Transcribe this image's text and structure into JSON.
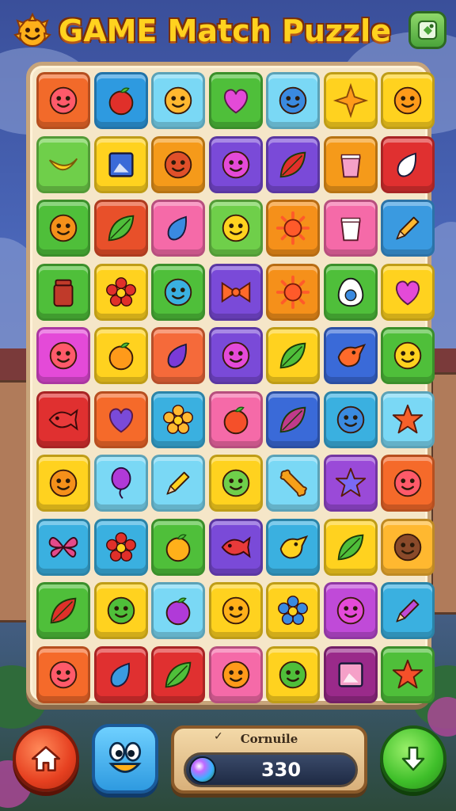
{
  "header": {
    "title": "GAME Match Puzzle",
    "logo_icon": "smiley-sun-icon",
    "menu_icon": "map-menu-icon"
  },
  "board": {
    "rows": 10,
    "cols": 7,
    "tiles": [
      {
        "icon": "face",
        "bg": "#f26a2a",
        "fg": "#ff5a6a"
      },
      {
        "icon": "fruit",
        "bg": "#2e9ae0",
        "fg": "#e0302a"
      },
      {
        "icon": "face",
        "bg": "#7ad8f5",
        "fg": "#ffb830"
      },
      {
        "icon": "heart",
        "bg": "#4fbf3a",
        "fg": "#e44ad8"
      },
      {
        "icon": "face",
        "bg": "#7ad8f5",
        "fg": "#3a8ae0"
      },
      {
        "icon": "star4",
        "bg": "#ffd21f",
        "fg": "#ff9a1a"
      },
      {
        "icon": "face",
        "bg": "#ffd21f",
        "fg": "#ff9a1a"
      },
      {
        "icon": "banana",
        "bg": "#6fcf4a",
        "fg": "#ffd21f"
      },
      {
        "icon": "frame",
        "bg": "#ffd21f",
        "fg": "#3a6ad8"
      },
      {
        "icon": "face",
        "bg": "#f59a1a",
        "fg": "#e0502a"
      },
      {
        "icon": "face",
        "bg": "#7a4ad8",
        "fg": "#e44ad8"
      },
      {
        "icon": "leaf",
        "bg": "#7a4ad8",
        "fg": "#e0302a"
      },
      {
        "icon": "cup",
        "bg": "#f59a1a",
        "fg": "#f5a0c8"
      },
      {
        "icon": "drop",
        "bg": "#e03030",
        "fg": "#ffffff"
      },
      {
        "icon": "face",
        "bg": "#4fbf3a",
        "fg": "#f5901a"
      },
      {
        "icon": "leaf",
        "bg": "#e8502a",
        "fg": "#4fbf3a"
      },
      {
        "icon": "drop",
        "bg": "#f56aa8",
        "fg": "#3a8ae0"
      },
      {
        "icon": "face",
        "bg": "#6fcf4a",
        "fg": "#ffd21f"
      },
      {
        "icon": "sun",
        "bg": "#f5901a",
        "fg": "#ff5a2a"
      },
      {
        "icon": "cup",
        "bg": "#f56aa8",
        "fg": "#ffffff"
      },
      {
        "icon": "pencil",
        "bg": "#3a9ae0",
        "fg": "#ffb830"
      },
      {
        "icon": "jar",
        "bg": "#4fbf3a",
        "fg": "#c03a2a"
      },
      {
        "icon": "flower",
        "bg": "#ffd21f",
        "fg": "#e0302a"
      },
      {
        "icon": "face",
        "bg": "#4fbf3a",
        "fg": "#3ab0e0"
      },
      {
        "icon": "bow",
        "bg": "#7a4ad8",
        "fg": "#ff6a2a"
      },
      {
        "icon": "sun",
        "bg": "#f5901a",
        "fg": "#ff5a2a"
      },
      {
        "icon": "egg",
        "bg": "#4fbf3a",
        "fg": "#ffffff"
      },
      {
        "icon": "heart",
        "bg": "#ffd21f",
        "fg": "#e44ad8"
      },
      {
        "icon": "face",
        "bg": "#e44ad8",
        "fg": "#ff5a6a"
      },
      {
        "icon": "fruit",
        "bg": "#ffd21f",
        "fg": "#ff9a1a"
      },
      {
        "icon": "drop",
        "bg": "#f56a3a",
        "fg": "#7a3ad8"
      },
      {
        "icon": "face",
        "bg": "#7a4ad8",
        "fg": "#e44ad8"
      },
      {
        "icon": "leaf",
        "bg": "#ffd21f",
        "fg": "#4fbf3a"
      },
      {
        "icon": "bird",
        "bg": "#3a6ad8",
        "fg": "#ff6a2a"
      },
      {
        "icon": "face",
        "bg": "#4fbf3a",
        "fg": "#ffd21f"
      },
      {
        "icon": "fish",
        "bg": "#e03030",
        "fg": "#e83a3a"
      },
      {
        "icon": "heart",
        "bg": "#f56a2a",
        "fg": "#7a4ad8"
      },
      {
        "icon": "flower",
        "bg": "#3ab0e0",
        "fg": "#ffb830"
      },
      {
        "icon": "fruit",
        "bg": "#f56aa8",
        "fg": "#f5502a"
      },
      {
        "icon": "leaf",
        "bg": "#3a6ad8",
        "fg": "#c03a8a"
      },
      {
        "icon": "face",
        "bg": "#3ab0e0",
        "fg": "#3a8ae0"
      },
      {
        "icon": "star",
        "bg": "#7ad8f5",
        "fg": "#f5602a"
      },
      {
        "icon": "face",
        "bg": "#ffd21f",
        "fg": "#f5901a"
      },
      {
        "icon": "balloon",
        "bg": "#7ad8f5",
        "fg": "#b03ad8"
      },
      {
        "icon": "pencil",
        "bg": "#7ad8f5",
        "fg": "#ffd21f"
      },
      {
        "icon": "face",
        "bg": "#ffd21f",
        "fg": "#6fcf4a"
      },
      {
        "icon": "bone",
        "bg": "#7ad8f5",
        "fg": "#f5a01a"
      },
      {
        "icon": "star",
        "bg": "#9a4ad8",
        "fg": "#7a6af5"
      },
      {
        "icon": "face",
        "bg": "#f56a2a",
        "fg": "#ff5a6a"
      },
      {
        "icon": "butterfly",
        "bg": "#3ab0e0",
        "fg": "#e44a8a"
      },
      {
        "icon": "flower",
        "bg": "#3ab0e0",
        "fg": "#e0302a"
      },
      {
        "icon": "fruit",
        "bg": "#4fbf3a",
        "fg": "#ffb01a"
      },
      {
        "icon": "fish",
        "bg": "#7a4ad8",
        "fg": "#e83a3a"
      },
      {
        "icon": "bird",
        "bg": "#3ab0e0",
        "fg": "#ffd21f"
      },
      {
        "icon": "leaf",
        "bg": "#ffd21f",
        "fg": "#4fbf3a"
      },
      {
        "icon": "face",
        "bg": "#ffb830",
        "fg": "#8a4a2a"
      },
      {
        "icon": "leaf",
        "bg": "#4fbf3a",
        "fg": "#e0302a"
      },
      {
        "icon": "face",
        "bg": "#ffd21f",
        "fg": "#4fbf3a"
      },
      {
        "icon": "fruit",
        "bg": "#7ad8f5",
        "fg": "#b03ad8"
      },
      {
        "icon": "face",
        "bg": "#ffd21f",
        "fg": "#ffb01a"
      },
      {
        "icon": "flower",
        "bg": "#ffd21f",
        "fg": "#3a8ae0"
      },
      {
        "icon": "face",
        "bg": "#c04ad8",
        "fg": "#e44ad8"
      },
      {
        "icon": "pencil",
        "bg": "#3ab0e0",
        "fg": "#c04ad8"
      },
      {
        "icon": "face",
        "bg": "#f56a2a",
        "fg": "#ff5a6a"
      },
      {
        "icon": "drop",
        "bg": "#e03030",
        "fg": "#3a9ae0"
      },
      {
        "icon": "leaf",
        "bg": "#e03030",
        "fg": "#4fbf3a"
      },
      {
        "icon": "face",
        "bg": "#f56aa8",
        "fg": "#ff9a1a"
      },
      {
        "icon": "face",
        "bg": "#ffd21f",
        "fg": "#4fbf3a"
      },
      {
        "icon": "frame",
        "bg": "#9a2a8a",
        "fg": "#f5a0c8"
      },
      {
        "icon": "star",
        "bg": "#4fbf3a",
        "fg": "#f5502a"
      }
    ]
  },
  "bottom": {
    "home_icon": "home-icon",
    "mascot_icon": "mascot-face-icon",
    "score_label": "Cornuile",
    "score_check": "✓",
    "score_value": "330",
    "download_icon": "down-arrow-icon"
  }
}
